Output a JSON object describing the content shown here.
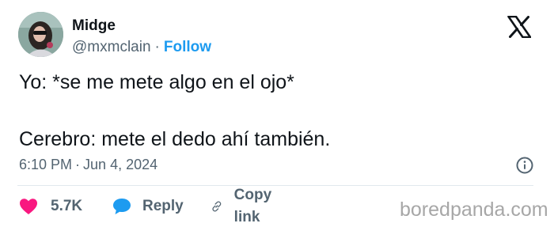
{
  "author": {
    "display_name": "Midge",
    "handle": "@mxmclain",
    "separator": "·",
    "follow_label": "Follow"
  },
  "tweet": {
    "line1": "Yo: *se me mete algo en el ojo*",
    "line2": "Cerebro: mete el dedo ahí también."
  },
  "meta": {
    "time": "6:10 PM",
    "separator": "·",
    "date": "Jun 4, 2024"
  },
  "actions": {
    "like_count": "5.7K",
    "reply_label": "Reply",
    "copy_label": "Copy link"
  },
  "icons": {
    "logo": "x-logo-icon",
    "info": "info-icon",
    "like": "heart-icon",
    "reply": "speech-bubble-icon",
    "copy": "link-icon"
  },
  "colors": {
    "accent": "#1d9bf0",
    "like": "#f91880",
    "text": "#0f1419",
    "muted": "#536471"
  },
  "watermark": "boredpanda.com"
}
